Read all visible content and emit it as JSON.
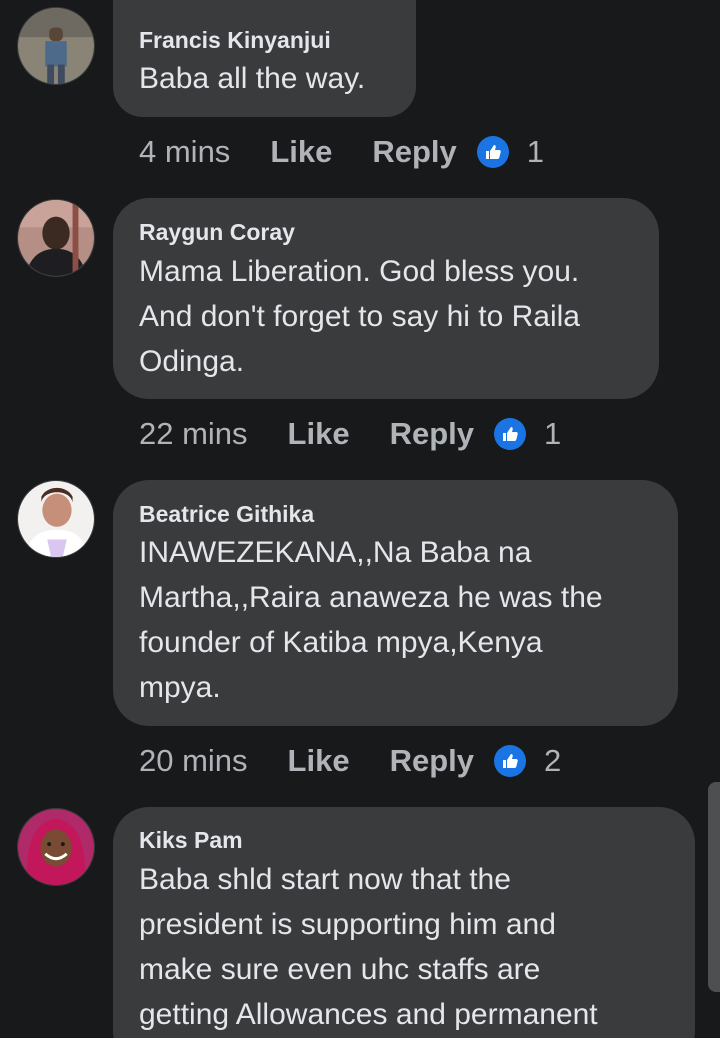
{
  "comments": [
    {
      "author": "Francis Kinyanjui",
      "text": "Baba all the way.",
      "time": "4 mins",
      "like_label": "Like",
      "reply_label": "Reply",
      "reaction_count": "1"
    },
    {
      "author": "Raygun Coray",
      "text": "Mama Liberation. God bless you.\nAnd don't forget to say hi to Raila\nOdinga.",
      "time": "22 mins",
      "like_label": "Like",
      "reply_label": "Reply",
      "reaction_count": "1"
    },
    {
      "author": "Beatrice Githika",
      "text": "INAWEZEKANA,,Na Baba na\nMartha,,Raira anaweza he was the\nfounder of Katiba mpya,Kenya\nmpya.",
      "time": "20 mins",
      "like_label": "Like",
      "reply_label": "Reply",
      "reaction_count": "2"
    },
    {
      "author": "Kiks Pam",
      "text": "Baba shld start now that the\npresident is supporting him and\nmake sure even uhc staffs are\ngetting Allowances and permanent",
      "time": "",
      "like_label": "",
      "reply_label": "",
      "reaction_count": ""
    }
  ],
  "colors": {
    "background": "#18191a",
    "bubble": "#3a3b3c",
    "primary_text": "#e4e6eb",
    "secondary_text": "#b0b3b8",
    "reaction_blue": "#1b74e4"
  },
  "icons": {
    "reaction": "thumbs-up-icon",
    "avatar": "avatar-photo"
  }
}
